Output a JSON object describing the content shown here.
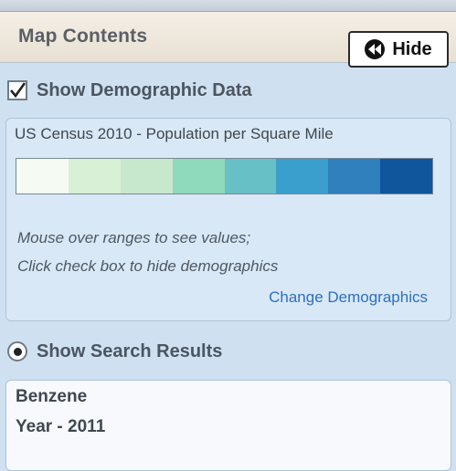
{
  "header": {
    "title": "Map Contents",
    "hide_button": {
      "label": "Hide",
      "icon": "rewind-icon"
    }
  },
  "demographics": {
    "checkbox_label": "Show Demographic Data",
    "checked": true,
    "dataset_title": "US Census 2010 - Population per Square Mile",
    "legend_colors": [
      "#f5fbf3",
      "#d8f0d6",
      "#c8e8cd",
      "#8fd9bd",
      "#67c0c5",
      "#3b9fce",
      "#2f80bd",
      "#0f569c"
    ],
    "hint_line1": "Mouse over ranges to see values;",
    "hint_line2": "Click check box to hide demographics",
    "change_link": "Change Demographics"
  },
  "search_results": {
    "radio_label": "Show Search Results",
    "selected": true,
    "items": [
      {
        "name": "Benzene",
        "year": "Year - 2011"
      }
    ]
  }
}
